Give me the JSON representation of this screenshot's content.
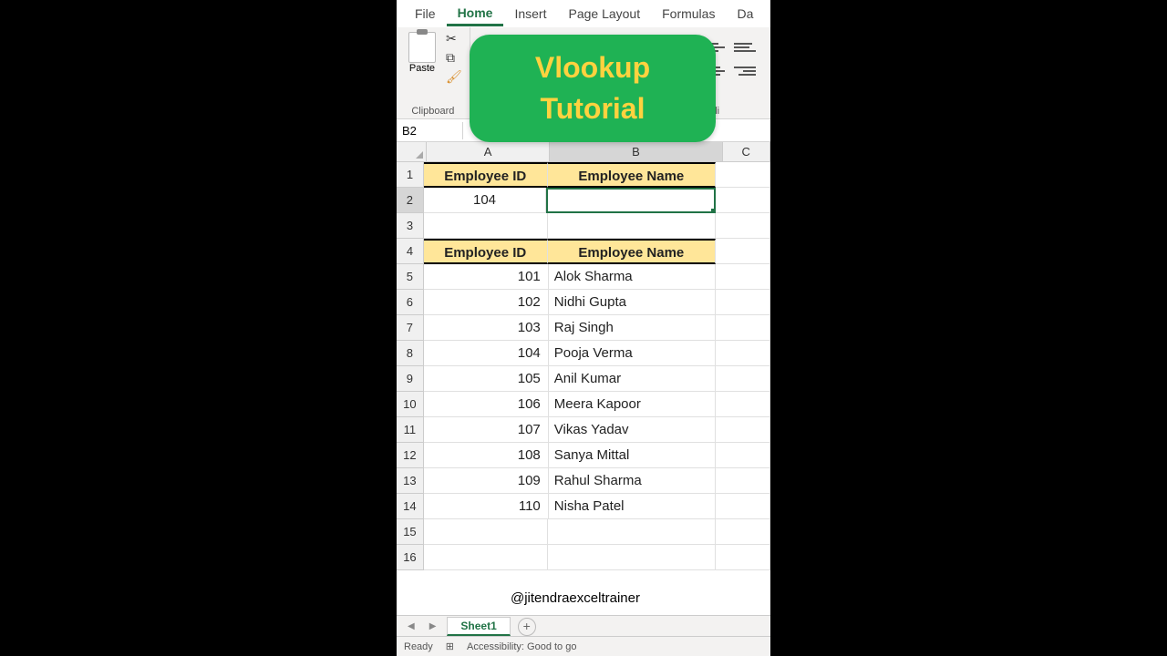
{
  "ribbon": {
    "tabs": [
      "File",
      "Home",
      "Insert",
      "Page Layout",
      "Formulas",
      "Da"
    ],
    "active_tab": "Home",
    "paste_label": "Paste",
    "clipboard_label": "Clipboard",
    "align_label_partial": "Ali"
  },
  "name_box": "B2",
  "overlay": {
    "line1": "Vlookup",
    "line2": "Tutorial"
  },
  "columns": [
    "A",
    "B",
    "C"
  ],
  "lookup": {
    "header_id": "Employee ID",
    "header_name": "Employee Name",
    "search_id": "104",
    "search_name": ""
  },
  "table": {
    "header_id": "Employee ID",
    "header_name": "Employee Name",
    "rows": [
      {
        "id": "101",
        "name": "Alok Sharma"
      },
      {
        "id": "102",
        "name": "Nidhi Gupta"
      },
      {
        "id": "103",
        "name": "Raj Singh"
      },
      {
        "id": "104",
        "name": "Pooja Verma"
      },
      {
        "id": "105",
        "name": "Anil Kumar"
      },
      {
        "id": "106",
        "name": "Meera Kapoor"
      },
      {
        "id": "107",
        "name": "Vikas Yadav"
      },
      {
        "id": "108",
        "name": "Sanya Mittal"
      },
      {
        "id": "109",
        "name": "Rahul Sharma"
      },
      {
        "id": "110",
        "name": "Nisha Patel"
      }
    ]
  },
  "row_numbers": [
    "1",
    "2",
    "3",
    "4",
    "5",
    "6",
    "7",
    "8",
    "9",
    "10",
    "11",
    "12",
    "13",
    "14",
    "15",
    "16"
  ],
  "watermark": "@jitendraexceltrainer",
  "sheet_tab": "Sheet1",
  "status": {
    "ready": "Ready",
    "accessibility": "Accessibility: Good to go"
  }
}
